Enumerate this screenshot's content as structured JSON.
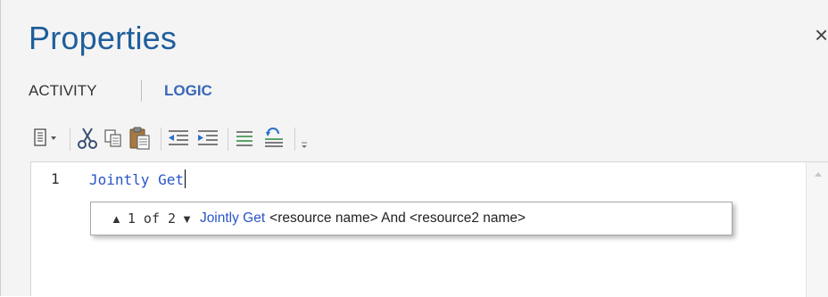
{
  "header": {
    "title": "Properties",
    "close_glyph": "×"
  },
  "tabs": [
    {
      "label": "ACTIVITY",
      "active": false
    },
    {
      "label": "LOGIC",
      "active": true
    }
  ],
  "toolbar": {
    "buttons": [
      {
        "icon": "document-menu-icon"
      },
      {
        "icon": "cut-icon"
      },
      {
        "icon": "copy-icon"
      },
      {
        "icon": "paste-icon"
      },
      {
        "icon": "outdent-icon"
      },
      {
        "icon": "indent-icon"
      },
      {
        "icon": "comment-lines-icon"
      },
      {
        "icon": "uncomment-lines-icon"
      },
      {
        "icon": "toolbar-overflow-icon"
      }
    ]
  },
  "editor": {
    "lines": [
      {
        "number": "1",
        "text": "Jointly Get"
      }
    ]
  },
  "tooltip": {
    "up_arrow": "▲",
    "counter": "1 of 2",
    "down_arrow": "▼",
    "keyword": "Jointly Get",
    "signature": "<resource name> And <resource2 name>"
  },
  "colors": {
    "title": "#1f5e9c",
    "active_tab": "#3a66b8",
    "keyword": "#2a55c9",
    "panel_background": "#f4f4f4"
  }
}
